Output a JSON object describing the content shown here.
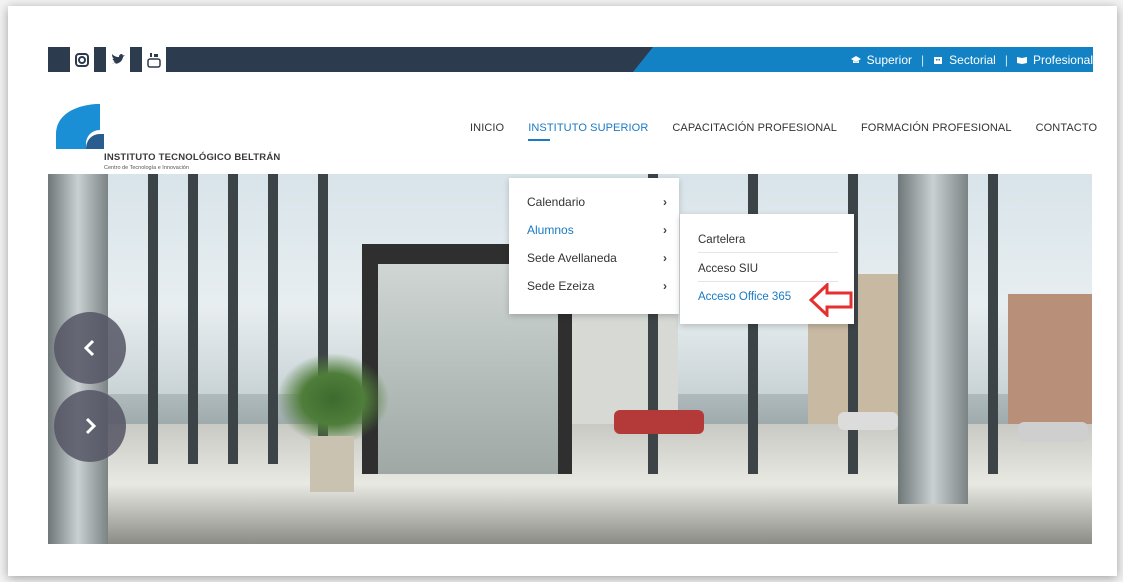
{
  "topbar": {
    "social": [
      {
        "icon": "facebook-icon",
        "label": "f"
      },
      {
        "icon": "instagram-icon",
        "label": ""
      },
      {
        "icon": "twitter-icon",
        "label": ""
      },
      {
        "icon": "youtube-icon",
        "label": ""
      }
    ],
    "links": [
      {
        "icon": "graduation-cap-icon",
        "label": "Superior"
      },
      {
        "icon": "building-icon",
        "label": "Sectorial"
      },
      {
        "icon": "book-icon",
        "label": "Profesional"
      }
    ],
    "separator": "|"
  },
  "logo": {
    "title": "INSTITUTO TECNOLÓGICO BELTRÁN",
    "subtitle": "Centro de Tecnología e Innovación"
  },
  "nav": {
    "items": [
      {
        "label": "INICIO"
      },
      {
        "label": "INSTITUTO SUPERIOR"
      },
      {
        "label": "CAPACITACIÓN PROFESIONAL"
      },
      {
        "label": "FORMACIÓN PROFESIONAL"
      },
      {
        "label": "CONTACTO"
      }
    ],
    "active_index": 1
  },
  "dropdown": {
    "items": [
      {
        "label": "Calendario"
      },
      {
        "label": "Alumnos"
      },
      {
        "label": "Sede Avellaneda"
      },
      {
        "label": "Sede Ezeiza"
      }
    ],
    "chevron": "›",
    "submenu": [
      {
        "label": "Cartelera"
      },
      {
        "label": "Acceso SIU"
      },
      {
        "label": "Acceso Office 365"
      }
    ]
  },
  "slider": {
    "prev": "‹",
    "next": "›"
  },
  "colors": {
    "accent": "#1a7ac3",
    "topbar_dark": "#2c3b4d",
    "topbar_blue": "#1282c5",
    "annotation_red": "#e53030"
  }
}
